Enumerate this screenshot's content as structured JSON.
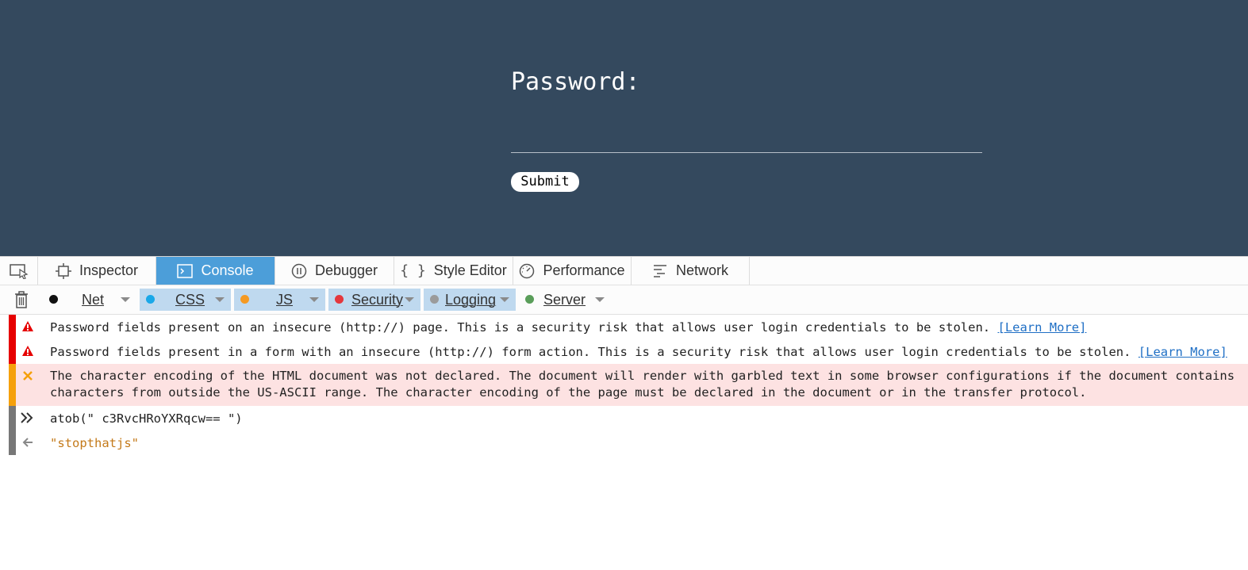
{
  "page": {
    "password_label": "Password:",
    "password_value": "",
    "submit_label": "Submit",
    "background": "#34495e"
  },
  "devtools": {
    "tabs": [
      {
        "label": "Inspector",
        "icon": "inspector-icon",
        "active": false
      },
      {
        "label": "Console",
        "icon": "console-icon",
        "active": true
      },
      {
        "label": "Debugger",
        "icon": "debugger-icon",
        "active": false
      },
      {
        "label": "Style Editor",
        "icon": "style-editor-icon",
        "active": false
      },
      {
        "label": "Performance",
        "icon": "performance-icon",
        "active": false
      },
      {
        "label": "Network",
        "icon": "network-icon",
        "active": false
      }
    ],
    "filters": [
      {
        "label": "Net",
        "color": "#111111",
        "active": false
      },
      {
        "label": "CSS",
        "color": "#1aa8e8",
        "active": true
      },
      {
        "label": "JS",
        "color": "#f59a23",
        "active": true
      },
      {
        "label": "Security",
        "color": "#e4373d",
        "active": true
      },
      {
        "label": "Logging",
        "color": "#9b9b9b",
        "active": true
      },
      {
        "label": "Server",
        "color": "#5a9e5a",
        "active": false
      }
    ],
    "messages": [
      {
        "type": "warning",
        "text": "Password fields present on an insecure (http://) page. This is a security risk that allows user login credentials to be stolen.",
        "link": "[Learn More]"
      },
      {
        "type": "warning",
        "text": "Password fields present in a form with an insecure (http://) form action. This is a security risk that allows user login credentials to be stolen.",
        "link": "[Learn More]"
      },
      {
        "type": "error",
        "line1": "The character encoding of the HTML document was not declared. The document will render with garbled text in some browser configurations if the document contains",
        "line2": "characters from outside the US-ASCII range. The character encoding of the page must be declared in the document or in the transfer protocol."
      },
      {
        "type": "input",
        "text": "atob(\" c3RvcHRoYXRqcw== \")"
      },
      {
        "type": "output",
        "text": "\"stopthatjs\""
      }
    ],
    "colors": {
      "security_bar": "#e60000",
      "error_bar": "#f5a00b",
      "error_bg": "#fde2e2",
      "input_bar": "#777777",
      "active_tab": "#4c9ed9"
    }
  }
}
